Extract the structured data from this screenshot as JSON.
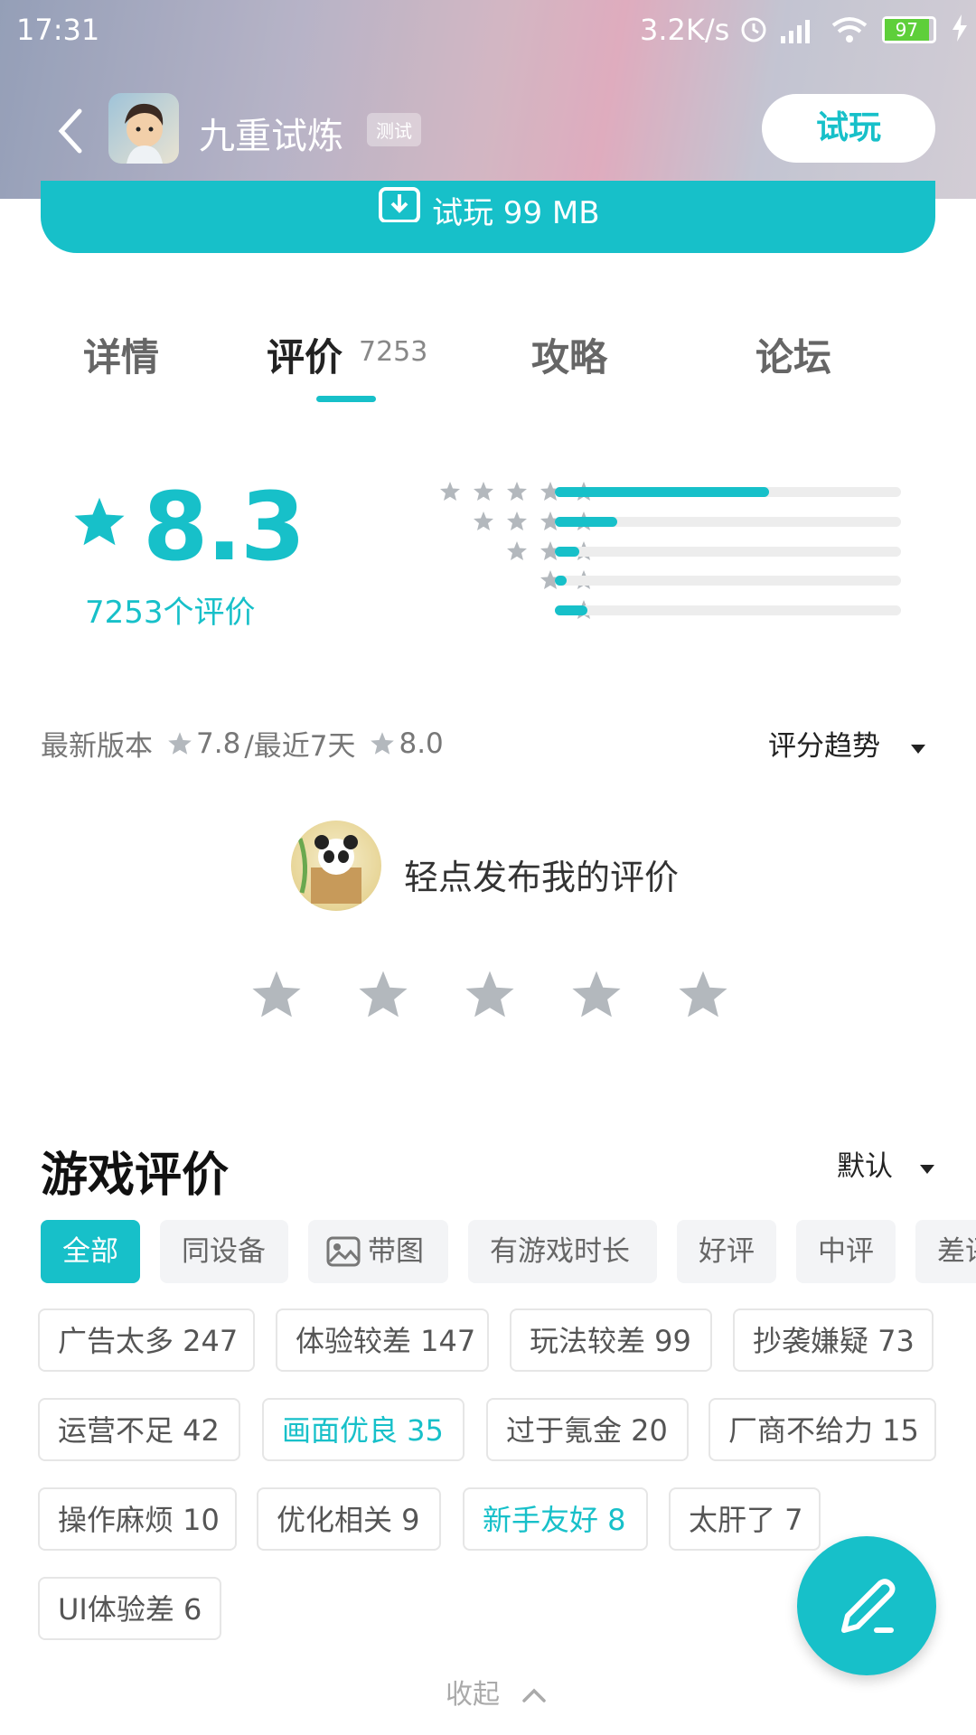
{
  "status_bar": {
    "time": "17:31",
    "speed": "3.2K/s",
    "battery": "97"
  },
  "header": {
    "app_name": "九重试炼",
    "badge": "测试",
    "try_button": "试玩"
  },
  "download": {
    "label": "试玩 99 MB"
  },
  "tabs": [
    {
      "label": "详情"
    },
    {
      "label": "评价",
      "count": "7253",
      "active": true
    },
    {
      "label": "攻略"
    },
    {
      "label": "论坛"
    }
  ],
  "rating": {
    "score": "8.3",
    "count_text": "7253个评价",
    "distribution": [
      {
        "stars": 5,
        "fraction": 0.62
      },
      {
        "stars": 4,
        "fraction": 0.18
      },
      {
        "stars": 3,
        "fraction": 0.07
      },
      {
        "stars": 2,
        "fraction": 0.035
      },
      {
        "stars": 1,
        "fraction": 0.095
      }
    ]
  },
  "version_line": {
    "prefix": "最新版本",
    "latest": "7.8",
    "sep": "/最近7天",
    "recent": "8.0"
  },
  "trend_label": "评分趋势",
  "post": {
    "prompt": "轻点发布我的评价"
  },
  "section": {
    "title": "游戏评价",
    "sort": "默认"
  },
  "filters": [
    "全部",
    "同设备",
    "带图",
    "有游戏时长",
    "好评",
    "中评",
    "差评"
  ],
  "tags": [
    {
      "label": "广告太多 247"
    },
    {
      "label": "体验较差 147"
    },
    {
      "label": "玩法较差 99"
    },
    {
      "label": "抄袭嫌疑 73"
    },
    {
      "label": "运营不足 42"
    },
    {
      "label": "画面优良 35",
      "highlight": true
    },
    {
      "label": "过于氪金 20"
    },
    {
      "label": "厂商不给力 15"
    },
    {
      "label": "操作麻烦 10"
    },
    {
      "label": "优化相关 9"
    },
    {
      "label": "新手友好 8",
      "highlight": true
    },
    {
      "label": "太肝了 7"
    },
    {
      "label": "UI体验差 6"
    }
  ],
  "collapse_label": "收起",
  "colors": {
    "accent": "#17c0c9",
    "star_gray": "#b3b8bd"
  }
}
